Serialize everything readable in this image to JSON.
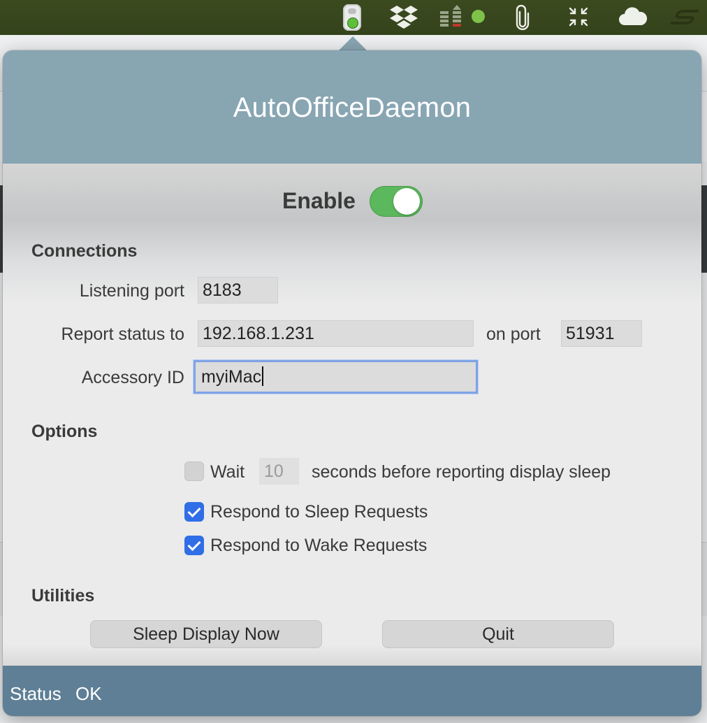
{
  "app": {
    "title": "AutoOfficeDaemon"
  },
  "menubar": {
    "icons": [
      "traffic-light-icon",
      "dropbox-icon",
      "stack-meter-icon",
      "paperclip-icon",
      "compress-icon",
      "cloud-icon",
      "s-icon"
    ]
  },
  "enable": {
    "label": "Enable",
    "on": true
  },
  "connections": {
    "heading": "Connections",
    "listening_port_label": "Listening port",
    "listening_port_value": "8183",
    "report_status_label": "Report status to",
    "report_status_value": "192.168.1.231",
    "on_port_label": "on port",
    "on_port_value": "51931",
    "accessory_id_label": "Accessory ID",
    "accessory_id_value": "myiMac"
  },
  "options": {
    "heading": "Options",
    "wait_label": "Wait",
    "wait_value": "10",
    "wait_suffix": "seconds before reporting display sleep",
    "wait_checked": false,
    "sleep_label": "Respond to Sleep Requests",
    "sleep_checked": true,
    "wake_label": "Respond to Wake Requests",
    "wake_checked": true
  },
  "utilities": {
    "heading": "Utilities",
    "sleep_button": "Sleep Display Now",
    "quit_button": "Quit"
  },
  "status": {
    "label": "Status",
    "value": "OK"
  },
  "colors": {
    "header": "#88a5b2",
    "status_bar": "#5e7f95",
    "toggle_on": "#5cb85c",
    "checkbox_on": "#2f6ee6",
    "focus_ring": "#7ea3e6"
  }
}
